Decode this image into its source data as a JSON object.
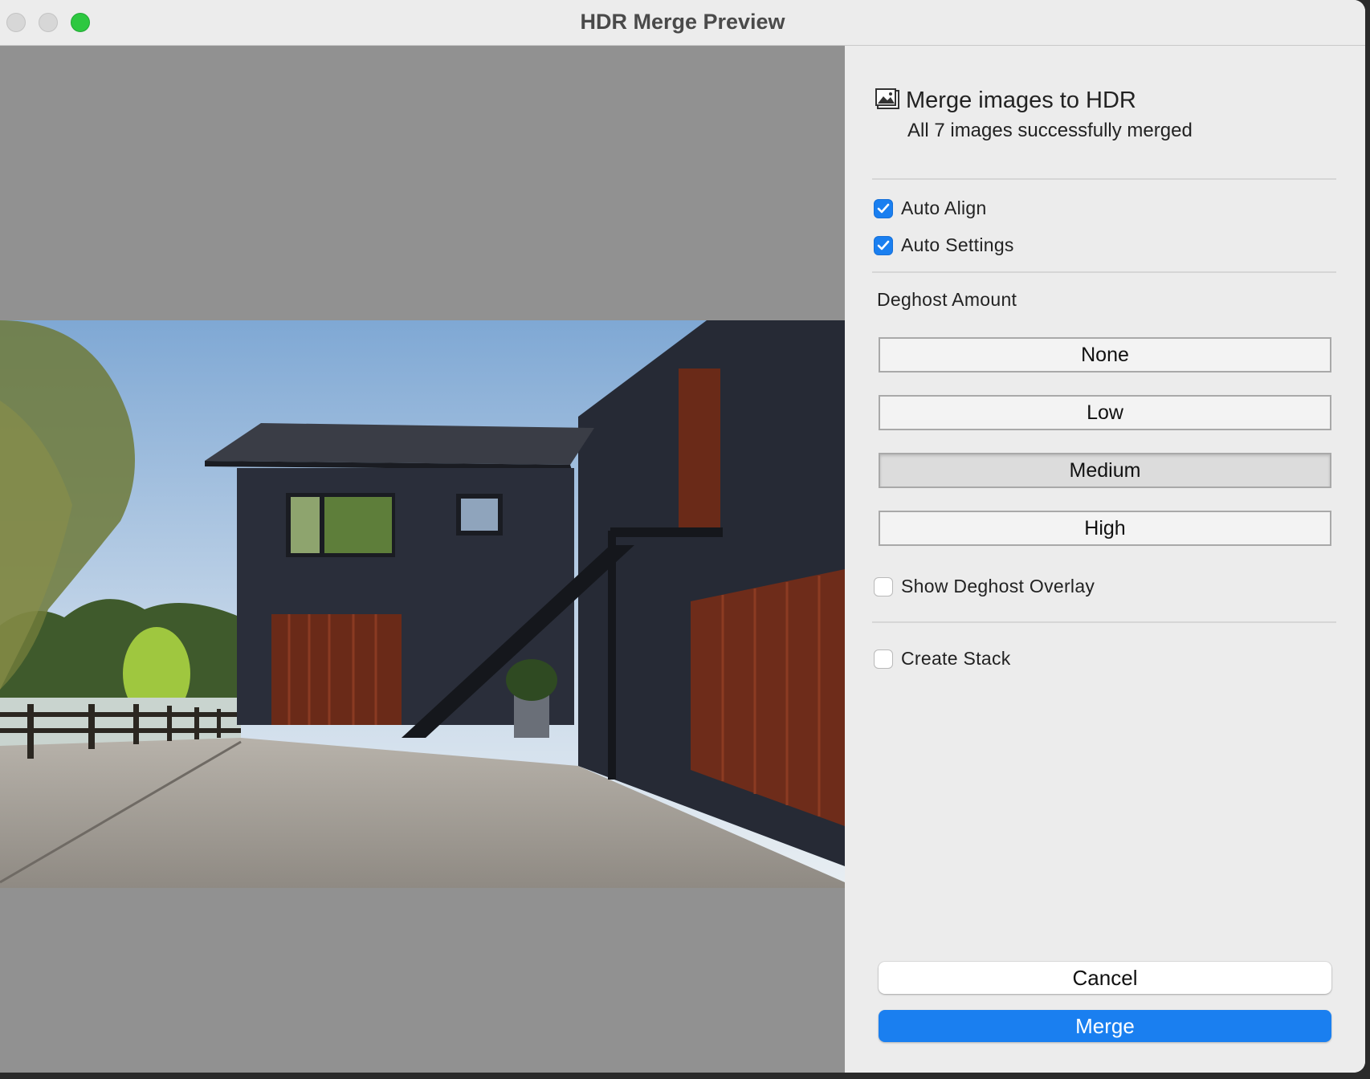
{
  "window": {
    "title": "HDR Merge Preview"
  },
  "panel": {
    "header_icon": "image-icon",
    "title": "Merge images to HDR",
    "subtitle": "All 7 images successfully merged",
    "options": {
      "auto_align": {
        "label": "Auto Align",
        "checked": true
      },
      "auto_settings": {
        "label": "Auto Settings",
        "checked": true
      },
      "show_deghost_overlay": {
        "label": "Show Deghost Overlay",
        "checked": false
      },
      "create_stack": {
        "label": "Create Stack",
        "checked": false
      }
    },
    "deghost": {
      "label": "Deghost Amount",
      "options": [
        "None",
        "Low",
        "Medium",
        "High"
      ],
      "selected": "Medium"
    },
    "buttons": {
      "cancel": "Cancel",
      "merge": "Merge"
    }
  },
  "colors": {
    "accent": "#1a7ff0",
    "window_bg": "#ececec",
    "preview_bg": "#919191",
    "zoom_button": "#2dc840"
  }
}
